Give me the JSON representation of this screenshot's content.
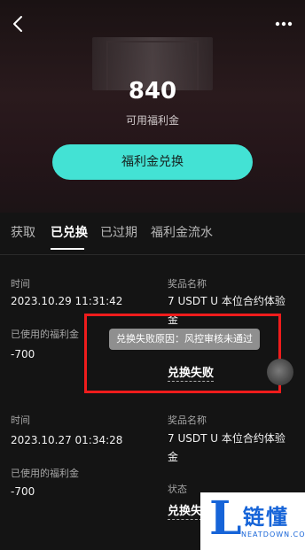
{
  "header": {
    "balance": "840",
    "balance_label": "可用福利金",
    "exchange_button": "福利金兑换"
  },
  "tabs": [
    {
      "label": "获取",
      "active": false
    },
    {
      "label": "已兑换",
      "active": true
    },
    {
      "label": "已过期",
      "active": false
    },
    {
      "label": "福利金流水",
      "active": false
    }
  ],
  "labels": {
    "time": "时间",
    "prize": "奖品名称",
    "used": "已使用的福利金",
    "status": "状态"
  },
  "records": [
    {
      "time": "2023.10.29 11:31:42",
      "used": "-700",
      "prize": "7 USDT U 本位合约体验金",
      "status": "兑换失败"
    },
    {
      "time": "2023.10.27 01:34:28",
      "used": "-700",
      "prize": "7 USDT U 本位合约体验金",
      "status": "兑换失"
    }
  ],
  "tooltip": "兑换失败原因：风控审核未通过",
  "watermark": {
    "letter": "L",
    "brand": "链懂",
    "site": "NEATDOWN.COM"
  },
  "colors": {
    "accent": "#43e2d4",
    "annotation": "#ef1c1c",
    "watermark": "#1664d8"
  }
}
